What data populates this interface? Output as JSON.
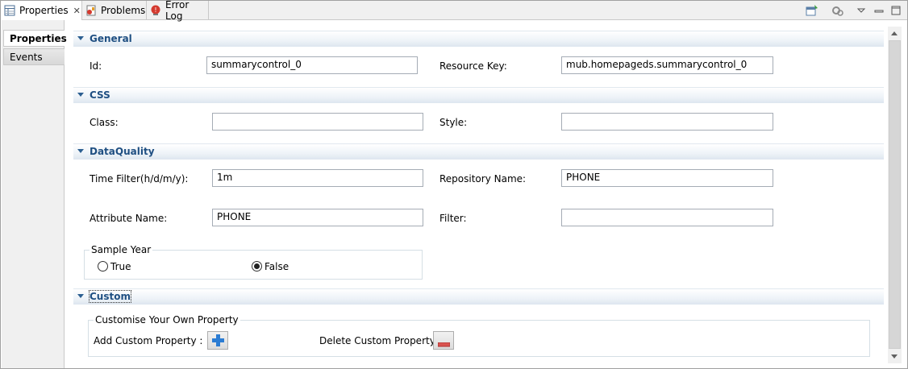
{
  "tabs": [
    {
      "label": "Properties",
      "icon": "properties-icon",
      "active": true
    },
    {
      "label": "Problems",
      "icon": "problems-icon",
      "active": false
    },
    {
      "label": "Error Log",
      "icon": "error-log-icon",
      "active": false
    }
  ],
  "toolbar": {
    "icons": [
      "pin-icon",
      "settings-icon",
      "view-menu-icon",
      "minimize-icon",
      "maximize-icon"
    ]
  },
  "left_tabs": [
    "Properties",
    "Events"
  ],
  "sections": {
    "general": {
      "title": "General",
      "id_label": "Id:",
      "id_value": "summarycontrol_0",
      "resource_key_label": "Resource Key:",
      "resource_key_value": "mub.homepageds.summarycontrol_0"
    },
    "css": {
      "title": "CSS",
      "class_label": "Class:",
      "class_value": "",
      "style_label": "Style:",
      "style_value": ""
    },
    "dataquality": {
      "title": "DataQuality",
      "time_filter_label": "Time Filter(h/d/m/y):",
      "time_filter_value": "1m",
      "repository_label": "Repository Name:",
      "repository_value": "PHONE",
      "attribute_label": "Attribute Name:",
      "attribute_value": "PHONE",
      "filter_label": "Filter:",
      "filter_value": "",
      "sample_year": {
        "legend": "Sample Year",
        "true_label": "True",
        "false_label": "False",
        "selected": "False"
      }
    },
    "custom": {
      "title": "Custom",
      "group_legend": "Customise Your Own Property",
      "add_label": "Add Custom Property :",
      "delete_label": "Delete Custom Property :"
    }
  },
  "colors": {
    "section_title": "#1f4f82",
    "add_icon": "#2b7cd3",
    "delete_icon": "#d9534f"
  }
}
